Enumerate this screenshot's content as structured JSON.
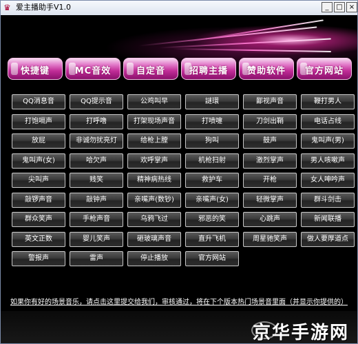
{
  "window": {
    "title": "爱主播助手V1.0",
    "minimize": "_",
    "maximize": "□",
    "close": "×"
  },
  "nav": [
    "快捷键",
    "MC音效",
    "自定音",
    "招聘主播",
    "赞助软件",
    "官方网站"
  ],
  "sounds": [
    [
      "QQ消息音",
      "QQ提示音",
      "公鸡叫早",
      "謎環",
      "鄙视声音",
      "鞭打男人"
    ],
    [
      "打饱嗝声",
      "打呼噜",
      "打架现场声音",
      "打喷嚏",
      "刀剑出鞘",
      "电话占线"
    ],
    [
      "放屁",
      "非诚勿扰亮灯",
      "给枪上膛",
      "狗叫",
      "鼓声",
      "鬼叫声(男)"
    ],
    [
      "鬼叫声(女)",
      "哈欠声",
      "欢呼掌声",
      "机枪扫射",
      "激烈掌声",
      "男人咳嗽声"
    ],
    [
      "尖叫声",
      "贱笑",
      "精神病热线",
      "救护车",
      "开枪",
      "女人呻吟声"
    ],
    [
      "敲锣声音",
      "敲钟声",
      "亲嘴声(数钞)",
      "亲嘴声(女)",
      "轻微掌声",
      "群斗剑击"
    ],
    [
      "群众笑声",
      "手枪声音",
      "乌鸦飞过",
      "邪恶的笑",
      "心跳声",
      "新闻联播"
    ],
    [
      "英文正数",
      "婴儿笑声",
      "砸玻璃声音",
      "直升飞机",
      "周星驰笑声",
      "做人要厚道点"
    ],
    [
      "警报声",
      "雷声",
      "停止播放",
      "官方网站"
    ]
  ],
  "notice": "如果你有好的场景音乐，请点击这里提交给我们，审核通过，将在下个版本热门场景音里面（并显示你提供的）",
  "watermark": "京华手游网",
  "colors": {
    "accent": "#c12d98",
    "button_bg": "#333333",
    "background": "#000000"
  }
}
